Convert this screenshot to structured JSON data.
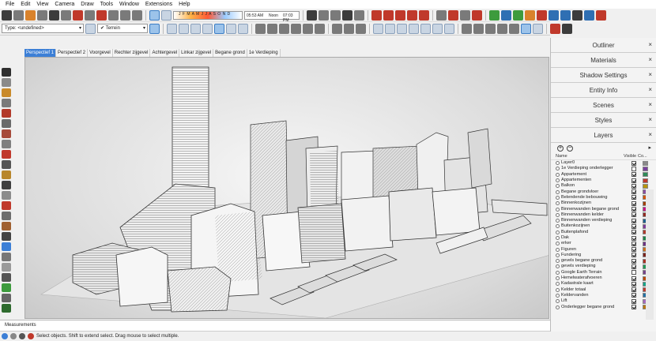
{
  "menu": [
    "File",
    "Edit",
    "View",
    "Camera",
    "Draw",
    "Tools",
    "Window",
    "Extensions",
    "Help"
  ],
  "shadow": {
    "months": "J F M A M J J A S O N D",
    "time_start": "05:53 AM",
    "time_mid": "Noon",
    "time_end": "07:03 PM"
  },
  "entity": {
    "type_label": "Type: <undefined>",
    "terrain_label": "Terrein"
  },
  "scene_tabs": [
    "Perspectief 1",
    "Perspectief 2",
    "Voorgevel",
    "Rechter zijgevel",
    "Achtergevel",
    "Linkar zijgevel",
    "Begane grond",
    "1e Verdieping"
  ],
  "active_tab_index": 0,
  "tray": {
    "panels": [
      "Outliner",
      "Materials",
      "Shadow Settings",
      "Entity Info",
      "Scenes",
      "Styles",
      "Layers"
    ],
    "close_glyph": "×",
    "layers": {
      "add_glyph": "+",
      "remove_glyph": "−",
      "details_glyph": "▸",
      "col_name": "Name",
      "col_visible": "Visible",
      "col_color": "Co...",
      "items": [
        {
          "name": "Layer0",
          "visible": true,
          "color": "#8a8a8a"
        },
        {
          "name": "1e Verdieping onderlegger",
          "visible": false,
          "color": "#7a3f9e"
        },
        {
          "name": "Appartement",
          "visible": true,
          "color": "#2e8b57"
        },
        {
          "name": "Appartementen",
          "visible": true,
          "color": "#c0392b"
        },
        {
          "name": "Balkon",
          "visible": true,
          "color": "#b7950b"
        },
        {
          "name": "Begane grondvloer",
          "visible": true,
          "color": "#884ea0"
        },
        {
          "name": "Belendende bebouwing",
          "visible": true,
          "color": "#d35400"
        },
        {
          "name": "Binnenkozijnen",
          "visible": true,
          "color": "#a04000"
        },
        {
          "name": "Binnenwanden begane grond",
          "visible": true,
          "color": "#c71585"
        },
        {
          "name": "Binnenwanden kelder",
          "visible": true,
          "color": "#922b21"
        },
        {
          "name": "Binnenwanden verdieping",
          "visible": true,
          "color": "#1f618d"
        },
        {
          "name": "Buitenkozijnen",
          "visible": true,
          "color": "#7d3c98"
        },
        {
          "name": "Buitenplafond",
          "visible": true,
          "color": "#b03a2e"
        },
        {
          "name": "Dak",
          "visible": true,
          "color": "#1e8449"
        },
        {
          "name": "erker",
          "visible": true,
          "color": "#6c3483"
        },
        {
          "name": "Figuren",
          "visible": true,
          "color": "#ca6f1e"
        },
        {
          "name": "Fundering",
          "visible": true,
          "color": "#7b241c"
        },
        {
          "name": "gevels begane grond",
          "visible": true,
          "color": "#a93226"
        },
        {
          "name": "gevels verdieping",
          "visible": true,
          "color": "#229954"
        },
        {
          "name": "Google Earth Terrain",
          "visible": false,
          "color": "#76448a"
        },
        {
          "name": "Hemelwaterafvoeren",
          "visible": true,
          "color": "#ba4a00"
        },
        {
          "name": "Kadastrale kaart",
          "visible": true,
          "color": "#17a589"
        },
        {
          "name": "Kelder totaal",
          "visible": true,
          "color": "#c0392b"
        },
        {
          "name": "Keldervanden",
          "visible": true,
          "color": "#2471a3"
        },
        {
          "name": "Lift",
          "visible": true,
          "color": "#a569bd"
        },
        {
          "name": "Onderlegger begane grond",
          "visible": true,
          "color": "#b9770e"
        }
      ]
    }
  },
  "measurements_label": "Measurements",
  "status_text": "Select objects. Shift to extend select. Drag mouse to select multiple.",
  "colors": {
    "accent": "#3c7fd6",
    "toolbar": "#f0f0f0",
    "viewport_bg": "#e3e3e3"
  }
}
